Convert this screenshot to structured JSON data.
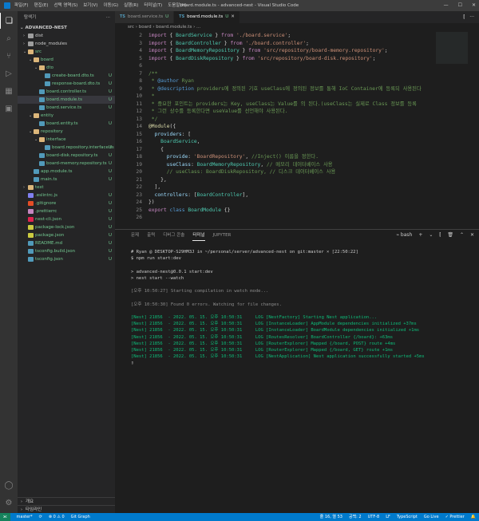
{
  "titlebar": {
    "menu": [
      "파일(F)",
      "편집(E)",
      "선택 영역(S)",
      "보기(V)",
      "이동(G)",
      "실행(R)",
      "터미널(T)",
      "도움말(H)"
    ],
    "title": "board.module.ts - advanced-nest - Visual Studio Code",
    "minimize": "—",
    "maximize": "☐",
    "close": "✕"
  },
  "activity": {
    "explorer": "❏",
    "search": "⌕",
    "git": "⑂",
    "debug": "▷",
    "extensions": "▦",
    "remote": "▣",
    "account": "◯",
    "settings": "⚙"
  },
  "sidebar": {
    "header": "탐색기",
    "header_menu": "···",
    "project": "ADVANCED-NEST",
    "tree": [
      {
        "indent": 1,
        "arrow": "›",
        "label": "dist",
        "color": "#9e9e9e",
        "badge": ""
      },
      {
        "indent": 1,
        "arrow": "›",
        "label": "node_modules",
        "color": "#9e9e9e",
        "badge": ""
      },
      {
        "indent": 1,
        "arrow": "⌄",
        "label": "src",
        "color": "#dcb67a",
        "badge": "",
        "dot": true
      },
      {
        "indent": 2,
        "arrow": "⌄",
        "label": "board",
        "color": "#dcb67a",
        "badge": "",
        "dot": true
      },
      {
        "indent": 3,
        "arrow": "⌄",
        "label": "dto",
        "color": "#dcb67a",
        "badge": "",
        "dot": true
      },
      {
        "indent": 4,
        "arrow": "",
        "label": "create-board.dto.ts",
        "color": "#519aba",
        "badge": "U",
        "ts": true
      },
      {
        "indent": 4,
        "arrow": "",
        "label": "response-board.dto.ts",
        "color": "#519aba",
        "badge": "U",
        "ts": true
      },
      {
        "indent": 3,
        "arrow": "",
        "label": "board.controller.ts",
        "color": "#519aba",
        "badge": "U",
        "ts": true
      },
      {
        "indent": 3,
        "arrow": "",
        "label": "board.module.ts",
        "color": "#519aba",
        "badge": "U",
        "ts": true,
        "selected": true
      },
      {
        "indent": 3,
        "arrow": "",
        "label": "board.service.ts",
        "color": "#519aba",
        "badge": "U",
        "ts": true
      },
      {
        "indent": 2,
        "arrow": "⌄",
        "label": "entity",
        "color": "#dcb67a",
        "badge": "",
        "dot": true
      },
      {
        "indent": 3,
        "arrow": "",
        "label": "board.entity.ts",
        "color": "#519aba",
        "badge": "U",
        "ts": true
      },
      {
        "indent": 2,
        "arrow": "⌄",
        "label": "repository",
        "color": "#dcb67a",
        "badge": "",
        "dot": true
      },
      {
        "indent": 3,
        "arrow": "⌄",
        "label": "interface",
        "color": "#dcb67a",
        "badge": "",
        "dot": true
      },
      {
        "indent": 4,
        "arrow": "",
        "label": "board.repository.interface.ts",
        "color": "#519aba",
        "badge": "U",
        "ts": true
      },
      {
        "indent": 3,
        "arrow": "",
        "label": "board-disk.repository.ts",
        "color": "#519aba",
        "badge": "U",
        "ts": true
      },
      {
        "indent": 3,
        "arrow": "",
        "label": "board-memory.repository.ts",
        "color": "#519aba",
        "badge": "U",
        "ts": true
      },
      {
        "indent": 2,
        "arrow": "",
        "label": "app.module.ts",
        "color": "#519aba",
        "badge": "U",
        "ts": true
      },
      {
        "indent": 2,
        "arrow": "",
        "label": "main.ts",
        "color": "#519aba",
        "badge": "U",
        "ts": true
      },
      {
        "indent": 1,
        "arrow": "›",
        "label": "test",
        "color": "#dcb67a",
        "badge": "",
        "dot": true
      },
      {
        "indent": 1,
        "arrow": "",
        "label": ".eslintrc.js",
        "color": "#8080f0",
        "badge": "U",
        "ts": true
      },
      {
        "indent": 1,
        "arrow": "",
        "label": ".gitignore",
        "color": "#e44d26",
        "badge": "U",
        "ts": true
      },
      {
        "indent": 1,
        "arrow": "",
        "label": ".prettierrc",
        "color": "#c586c0",
        "badge": "U",
        "ts": true
      },
      {
        "indent": 1,
        "arrow": "",
        "label": "nest-cli.json",
        "color": "#e0234e",
        "badge": "U",
        "ts": true
      },
      {
        "indent": 1,
        "arrow": "",
        "label": "package-lock.json",
        "color": "#cbcb41",
        "badge": "U",
        "ts": true
      },
      {
        "indent": 1,
        "arrow": "",
        "label": "package.json",
        "color": "#cbcb41",
        "badge": "U",
        "ts": true
      },
      {
        "indent": 1,
        "arrow": "",
        "label": "README.md",
        "color": "#519aba",
        "badge": "U",
        "ts": true
      },
      {
        "indent": 1,
        "arrow": "",
        "label": "tsconfig.build.json",
        "color": "#519aba",
        "badge": "U",
        "ts": true
      },
      {
        "indent": 1,
        "arrow": "",
        "label": "tsconfig.json",
        "color": "#519aba",
        "badge": "U",
        "ts": true
      }
    ],
    "bottom": [
      {
        "arrow": "›",
        "label": "개요"
      },
      {
        "arrow": "›",
        "label": "타임라인"
      }
    ]
  },
  "tabs": [
    {
      "label": "board.service.ts",
      "status": "U",
      "icon": "TS",
      "active": false
    },
    {
      "label": "board.module.ts",
      "status": "U",
      "icon": "TS",
      "active": true
    }
  ],
  "tab_close": "✕",
  "editor_actions": [
    "⫿",
    "···"
  ],
  "breadcrumb": "src › board › board.module.ts › ...",
  "editor_lines": [
    {
      "n": "2",
      "html": "<span class='kw'>import</span> { <span class='ty'>BoardService</span> } <span class='kw'>from</span> <span class='str'>'./board.service'</span>;"
    },
    {
      "n": "3",
      "html": "<span class='kw'>import</span> { <span class='ty'>BoardController</span> } <span class='kw'>from</span> <span class='str'>'./board.controller'</span>;"
    },
    {
      "n": "4",
      "html": "<span class='kw'>import</span> { <span class='ty'>BoardMemoryRepository</span> } <span class='kw'>from</span> <span class='str'>'src/repository/board-memory.repository'</span>;"
    },
    {
      "n": "5",
      "html": "<span class='kw'>import</span> { <span class='ty'>BoardDiskRepository</span> } <span class='kw'>from</span> <span class='str'>'src/repository/board-disk.repository'</span>;"
    },
    {
      "n": "6",
      "html": ""
    },
    {
      "n": "7",
      "html": "<span class='cm'>/**</span>"
    },
    {
      "n": "8",
      "html": "<span class='cm'> * </span><span class='kb'>@author</span><span class='cm'> Ryan</span>"
    },
    {
      "n": "9",
      "html": "<span class='cm'> * </span><span class='kb'>@description</span><span class='cm'> providers에 정의된 기호 useClass에 정의된 정보를 통해 IoC Container에 등록되 사용된다</span>"
    },
    {
      "n": "10",
      "html": "<span class='cm'> *</span>"
    },
    {
      "n": "11",
      "html": "<span class='cm'> * 중요한 포인트는 providers는 Key, useClass는 Value를 의 된다.(useClass는 실제로 Class 정보를 등록</span>"
    },
    {
      "n": "12",
      "html": "<span class='cm'> * 그런 상수를 등록한다면 useValue를 선언해야 사용된다.</span>"
    },
    {
      "n": "13",
      "html": "<span class='cm'> */</span>"
    },
    {
      "n": "14",
      "html": "<span class='dec'>@Module</span>({"
    },
    {
      "n": "15",
      "html": "  <span class='pr'>providers</span>: ["
    },
    {
      "n": "16",
      "html": "    <span class='ty'>BoardService</span>,"
    },
    {
      "n": "17",
      "html": "    {"
    },
    {
      "n": "18",
      "html": "      <span class='pr'>provide</span>: <span class='str'>'BoardRepository'</span>, <span class='cm'>//Inject() 이름을 정한다.</span>"
    },
    {
      "n": "19",
      "html": "      <span class='pr'>useClass</span>: <span class='ty'>BoardMemoryRepository</span>, <span class='cm'>// 메모리 데이터베이스 사용</span>"
    },
    {
      "n": "20",
      "html": "      <span class='cm'>// useClass: BoardDiskRepository, // 디스크 데이터베이스 사용</span>"
    },
    {
      "n": "21",
      "html": "    },"
    },
    {
      "n": "22",
      "html": "  ],"
    },
    {
      "n": "23",
      "html": "  <span class='pr'>controllers</span>: [<span class='ty'>BoardController</span>],"
    },
    {
      "n": "24",
      "html": "})"
    },
    {
      "n": "25",
      "html": "<span class='kw'>export</span> <span class='kb'>class</span> <span class='ty'>BoardModule</span> {}"
    },
    {
      "n": "26",
      "html": ""
    }
  ],
  "panel": {
    "tabs": [
      "문제",
      "출력",
      "디버그 콘솔",
      "터미널",
      "JUPYTER"
    ],
    "active_tab": 3,
    "actions": [
      "⌁ bash",
      "+",
      "⌄",
      "⫿",
      "🗑",
      "⌃",
      "✕"
    ]
  },
  "terminal_lines": [
    {
      "cls": "",
      "text": "# Ryan @ DESKTOP-S29HM3J in ~/personal/server/advanced-nest on git:master × [22:50:22]"
    },
    {
      "cls": "",
      "text": "$ npm run start:dev"
    },
    {
      "cls": "",
      "text": ""
    },
    {
      "cls": "",
      "text": "> advanced-nest@0.0.1 start:dev"
    },
    {
      "cls": "",
      "text": "> nest start --watch"
    },
    {
      "cls": "",
      "text": ""
    },
    {
      "cls": "t-gray",
      "text": "[오후 10:50:27] Starting compilation in watch mode..."
    },
    {
      "cls": "",
      "text": ""
    },
    {
      "cls": "t-gray",
      "text": "[오후 10:50:30] Found 0 errors. Watching for file changes."
    },
    {
      "cls": "",
      "text": ""
    },
    {
      "cls": "t-green",
      "text": "[Nest] 21856  - 2022. 05. 15. 오후 10:50:31     LOG [NestFactory] Starting Nest application..."
    },
    {
      "cls": "t-green",
      "text": "[Nest] 21856  - 2022. 05. 15. 오후 10:50:31     LOG [InstanceLoader] AppModule dependencies initialized +37ms"
    },
    {
      "cls": "t-green",
      "text": "[Nest] 21856  - 2022. 05. 15. 오후 10:50:31     LOG [InstanceLoader] BoardModule dependencies initialized +1ms"
    },
    {
      "cls": "t-green",
      "text": "[Nest] 21856  - 2022. 05. 15. 오후 10:50:31     LOG [RoutesResolver] BoardController {/board}: +63ms"
    },
    {
      "cls": "t-green",
      "text": "[Nest] 21856  - 2022. 05. 15. 오후 10:50:31     LOG [RouterExplorer] Mapped {/board, POST} route +4ms"
    },
    {
      "cls": "t-green",
      "text": "[Nest] 21856  - 2022. 05. 15. 오후 10:50:31     LOG [RouterExplorer] Mapped {/board, GET} route +1ms"
    },
    {
      "cls": "t-green",
      "text": "[Nest] 21856  - 2022. 05. 15. 오후 10:50:31     LOG [NestApplication] Nest application successfully started +5ms"
    },
    {
      "cls": "",
      "text": "▯"
    }
  ],
  "statusbar": {
    "remote": "⫘",
    "branch": "master*",
    "sync": "⟳",
    "problems": "⊗ 0 ⚠ 0",
    "git_graph": "Git Graph",
    "position": "줄 16, 열 53",
    "spaces": "공백: 2",
    "encoding": "UTF-8",
    "eol": "LF",
    "language": "TypeScript",
    "golive": "Go Live",
    "prettier": "✓ Prettier",
    "notify": "🔔"
  }
}
